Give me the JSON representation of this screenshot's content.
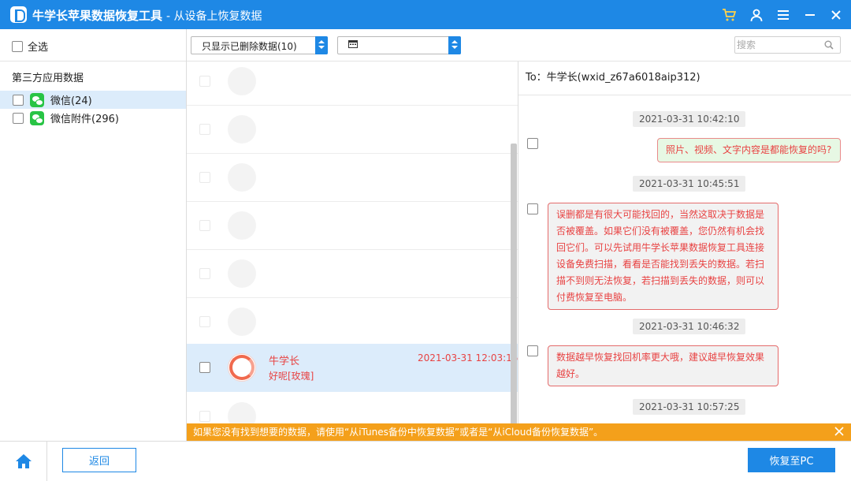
{
  "window": {
    "title": "牛学长苹果数据恢复工具",
    "subtitle": "-  从设备上恢复数据",
    "controls": [
      "cart-icon",
      "user-icon",
      "menu-icon",
      "minimize-icon",
      "close-icon"
    ]
  },
  "toolbar": {
    "select_all": "全选",
    "filter_value": "只显示已删除数据(10)",
    "date_value": "",
    "search_placeholder": "搜索"
  },
  "sidebar": {
    "category": "第三方应用数据",
    "items": [
      {
        "label": "微信(24)",
        "selected": true
      },
      {
        "label": "微信附件(296)",
        "selected": false
      }
    ]
  },
  "conversations": [
    {
      "name": "",
      "preview": "",
      "time": "",
      "faded": true
    },
    {
      "name": "",
      "preview": "",
      "time": "",
      "faded": true
    },
    {
      "name": "",
      "preview": "",
      "time": "",
      "faded": true
    },
    {
      "name": "",
      "preview": "",
      "time": "",
      "faded": true
    },
    {
      "name": "",
      "preview": "",
      "time": "",
      "faded": true
    },
    {
      "name": "",
      "preview": "",
      "time": "",
      "faded": true
    },
    {
      "name": "牛学长",
      "preview": "好呢[玫瑰]",
      "time": "2021-03-31 12:03:15",
      "selected": true
    },
    {
      "name": "",
      "preview": "",
      "time": "",
      "faded": true
    }
  ],
  "chat": {
    "to": "To：牛学长(wxid_z67a6018aip312)",
    "timestamps": [
      "2021-03-31 10:42:10",
      "2021-03-31 10:45:51",
      "2021-03-31 10:46:32",
      "2021-03-31 10:57:25"
    ],
    "messages": [
      {
        "text": "照片、视频、文字内容是都能恢复的吗?",
        "dir": "out"
      },
      {
        "text": "误删都是有很大可能找回的，当然这取决于数据是否被覆盖。如果它们没有被覆盖，您仍然有机会找回它们。可以先试用牛学长苹果数据恢复工具连接设备免费扫描，看看是否能找到丢失的数据。若扫描不到则无法恢复，若扫描到丢失的数据，则可以付费恢复至电脑。",
        "dir": "in"
      },
      {
        "text": "数据越早恢复找回机率更大哦，建议越早恢复效果越好。",
        "dir": "in"
      }
    ]
  },
  "notice": "如果您没有找到想要的数据，请使用“从iTunes备份中恢复数据”或者是“从iCloud备份恢复数据”。",
  "footer": {
    "back_label": "返回",
    "recover_label": "恢复至PC"
  },
  "colors": {
    "primary": "#1e88e5",
    "deleted_text": "#e84343",
    "notice_bg": "#f4a01b",
    "selection_bg": "#dcecfb"
  }
}
